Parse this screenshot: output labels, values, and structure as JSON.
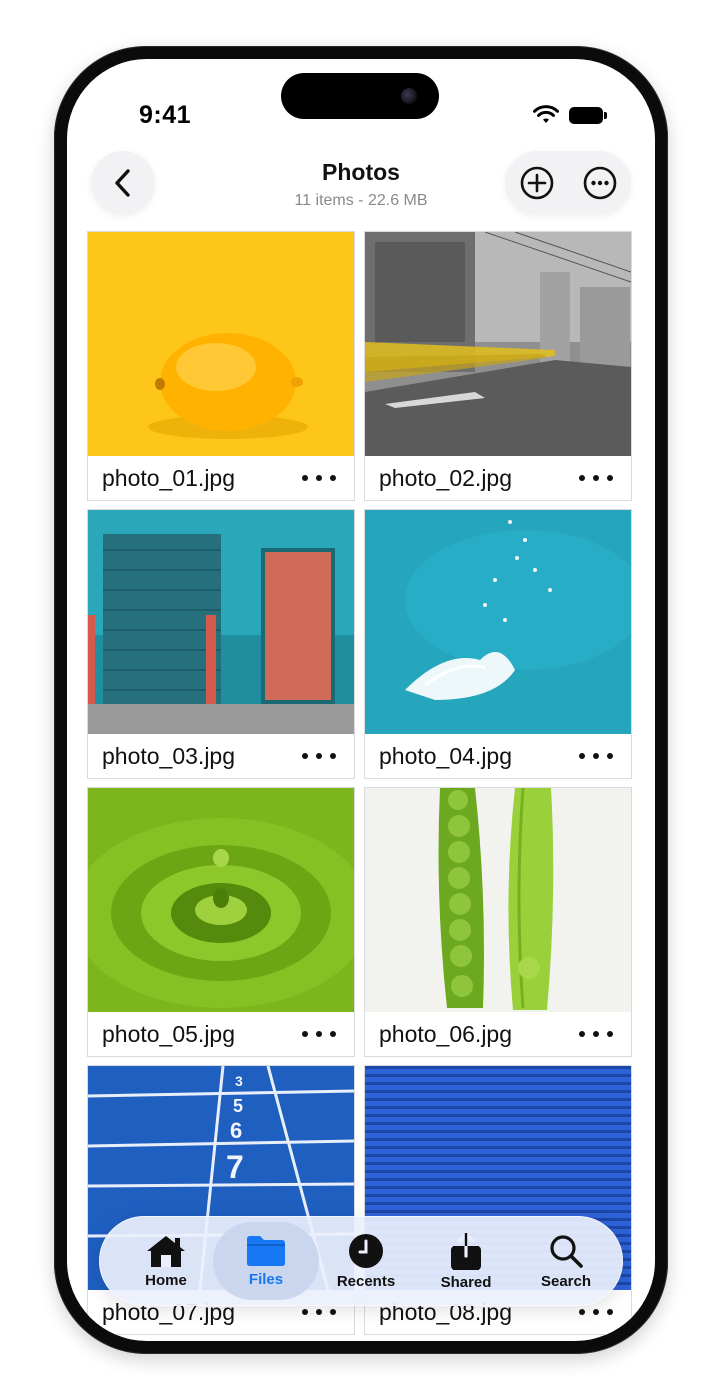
{
  "status": {
    "time": "9:41"
  },
  "nav": {
    "title": "Photos",
    "subtitle": "11 items - 22.6 MB"
  },
  "files": [
    {
      "name": "photo_01.jpg",
      "image": "lemon on yellow background"
    },
    {
      "name": "photo_02.jpg",
      "image": "street with yellow tram motion blur"
    },
    {
      "name": "photo_03.jpg",
      "image": "teal wall with garage door and red door"
    },
    {
      "name": "photo_04.jpg",
      "image": "aerial turquoise sea with wave"
    },
    {
      "name": "photo_05.jpg",
      "image": "green water drop ripple"
    },
    {
      "name": "photo_06.jpg",
      "image": "two green pea pods"
    },
    {
      "name": "photo_07.jpg",
      "image": "blue running track lanes"
    },
    {
      "name": "photo_08.jpg",
      "image": "blue corrugated shutter"
    }
  ],
  "tabs": [
    {
      "label": "Home",
      "icon": "house-icon"
    },
    {
      "label": "Files",
      "icon": "folder-icon",
      "active": true
    },
    {
      "label": "Recents",
      "icon": "clock-icon"
    },
    {
      "label": "Shared",
      "icon": "share-icon"
    },
    {
      "label": "Search",
      "icon": "magnifier-icon"
    }
  ],
  "colors": {
    "accent": "#1877f2"
  }
}
